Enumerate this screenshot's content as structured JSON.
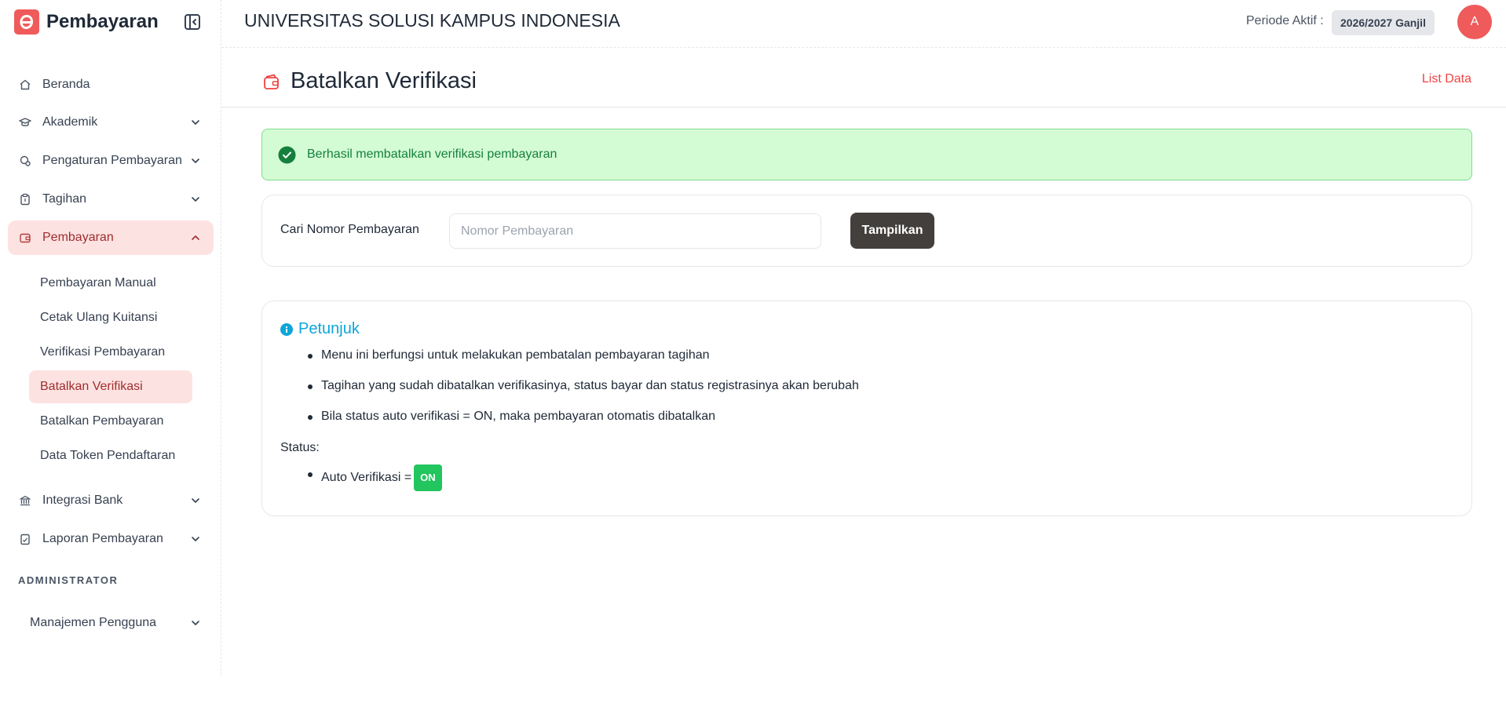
{
  "app": {
    "name": "Pembayaran",
    "logo_letter": "e",
    "accent_color": "#ef5b5b"
  },
  "sidebar": {
    "items": [
      {
        "label": "Beranda",
        "icon": "home-icon"
      },
      {
        "label": "Akademik",
        "icon": "graduation-cap-icon"
      },
      {
        "label": "Pengaturan Pembayaran",
        "icon": "settings-coin-icon"
      },
      {
        "label": "Tagihan",
        "icon": "clipboard-icon"
      },
      {
        "label": "Pembayaran",
        "icon": "wallet-icon"
      },
      {
        "label": "Integrasi Bank",
        "icon": "bank-icon"
      },
      {
        "label": "Laporan Pembayaran",
        "icon": "report-icon"
      }
    ],
    "submenu": [
      "Pembayaran Manual",
      "Cetak Ulang Kuitansi",
      "Verifikasi Pembayaran",
      "Batalkan Verifikasi",
      "Batalkan Pembayaran",
      "Data Token Pendaftaran"
    ],
    "section_admin": "ADMINISTRATOR",
    "admin_items": [
      {
        "label": "Manajemen Pengguna"
      }
    ]
  },
  "header": {
    "university": "UNIVERSITAS SOLUSI KAMPUS INDONESIA",
    "periode_label": "Periode Aktif :",
    "periode_value": "2026/2027 Ganjil",
    "avatar_initial": "A"
  },
  "page": {
    "title": "Batalkan Verifikasi",
    "list_data_link": "List Data"
  },
  "alert": {
    "message": "Berhasil membatalkan verifikasi pembayaran"
  },
  "search": {
    "label": "Cari Nomor Pembayaran",
    "placeholder": "Nomor Pembayaran",
    "value": "",
    "button": "Tampilkan"
  },
  "info": {
    "title": "Petunjuk",
    "items": [
      "Menu ini berfungsi untuk melakukan pembatalan pembayaran tagihan",
      "Tagihan yang sudah dibatalkan verifikasinya, status bayar dan status registrasinya akan berubah",
      "Bila status auto verifikasi = ON, maka pembayaran otomatis dibatalkan"
    ],
    "status_label": "Status:",
    "status_item_label": "Auto Verifikasi =",
    "status_item_value": "ON"
  }
}
